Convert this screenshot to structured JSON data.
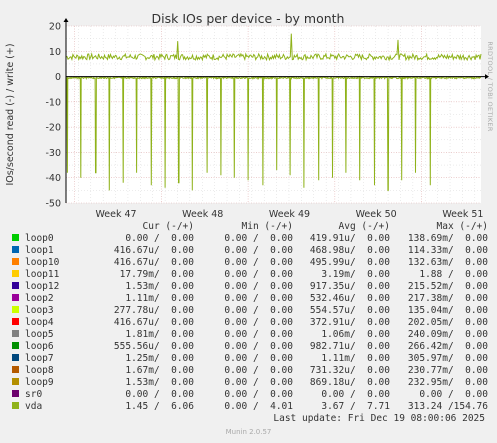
{
  "chart_data": {
    "type": "line",
    "title": "Disk IOs per device - by month",
    "ylabel": "IOs/second read (-) / write (+)",
    "ylim": [
      -50,
      20
    ],
    "yticks": [
      20,
      10,
      0,
      -10,
      -20,
      -30,
      -40,
      -50
    ],
    "xlabels": [
      "Week 47",
      "Week 48",
      "Week 49",
      "Week 50",
      "Week 51"
    ],
    "grid": true,
    "series": [
      {
        "name": "vda",
        "color": "#8fb21a",
        "write_baseline": 7.8,
        "write_noise": 1.2,
        "write_spikes": [
          {
            "day": 9.0,
            "value": 14
          },
          {
            "day": 18.2,
            "value": 17
          },
          {
            "day": 26.8,
            "value": 14.5
          }
        ],
        "read_baseline": -0.2,
        "read_spike_days": [
          0.1,
          1.2,
          2.4,
          3.5,
          4.6,
          5.7,
          6.9,
          8.0,
          9.1,
          10.2,
          11.4,
          12.5,
          13.6,
          14.7,
          15.9,
          17.0,
          18.1,
          19.2,
          20.4,
          21.5,
          22.6,
          23.7,
          24.9,
          26.0,
          27.1,
          28.2,
          29.4
        ],
        "read_spike_values": [
          -38,
          -40,
          -38,
          -45,
          -42,
          -38,
          -43,
          -44,
          -42,
          -45,
          -38,
          -39,
          -40,
          -41,
          -43,
          -37,
          -39,
          -44,
          -41,
          -40,
          -38,
          -41,
          -43,
          -45,
          -41,
          -38,
          -43
        ]
      }
    ]
  },
  "watermark": "RRDTOOL / TOBI OETIKER",
  "legend": {
    "headers": {
      "cur": "Cur (-/+)",
      "min": "Min (-/+)",
      "avg": "Avg (-/+)",
      "max": "Max (-/+)"
    },
    "rows": [
      {
        "name": "loop0",
        "color": "#00cc00",
        "cur": "0.00 /  0.00",
        "min": "0.00 /  0.00",
        "avg": "419.91u/  0.00",
        "max": "138.69m/  0.00"
      },
      {
        "name": "loop1",
        "color": "#0066b3",
        "cur": "416.67u/  0.00",
        "min": "0.00 /  0.00",
        "avg": "468.98u/  0.00",
        "max": "114.33m/  0.00"
      },
      {
        "name": "loop10",
        "color": "#ff8000",
        "cur": "416.67u/  0.00",
        "min": "0.00 /  0.00",
        "avg": "495.99u/  0.00",
        "max": "132.63m/  0.00"
      },
      {
        "name": "loop11",
        "color": "#ffcc00",
        "cur": "17.79m/  0.00",
        "min": "0.00 /  0.00",
        "avg": "3.19m/  0.00",
        "max": "1.88 /  0.00"
      },
      {
        "name": "loop12",
        "color": "#330099",
        "cur": "1.53m/  0.00",
        "min": "0.00 /  0.00",
        "avg": "917.35u/  0.00",
        "max": "215.52m/  0.00"
      },
      {
        "name": "loop2",
        "color": "#990099",
        "cur": "1.11m/  0.00",
        "min": "0.00 /  0.00",
        "avg": "532.46u/  0.00",
        "max": "217.38m/  0.00"
      },
      {
        "name": "loop3",
        "color": "#ccff00",
        "cur": "277.78u/  0.00",
        "min": "0.00 /  0.00",
        "avg": "554.57u/  0.00",
        "max": "135.04m/  0.00"
      },
      {
        "name": "loop4",
        "color": "#ff0000",
        "cur": "416.67u/  0.00",
        "min": "0.00 /  0.00",
        "avg": "372.91u/  0.00",
        "max": "202.05m/  0.00"
      },
      {
        "name": "loop5",
        "color": "#808080",
        "cur": "1.81m/  0.00",
        "min": "0.00 /  0.00",
        "avg": "1.06m/  0.00",
        "max": "240.09m/  0.00"
      },
      {
        "name": "loop6",
        "color": "#008f00",
        "cur": "555.56u/  0.00",
        "min": "0.00 /  0.00",
        "avg": "982.71u/  0.00",
        "max": "266.42m/  0.00"
      },
      {
        "name": "loop7",
        "color": "#00487d",
        "cur": "1.25m/  0.00",
        "min": "0.00 /  0.00",
        "avg": "1.11m/  0.00",
        "max": "305.97m/  0.00"
      },
      {
        "name": "loop8",
        "color": "#b35a00",
        "cur": "1.67m/  0.00",
        "min": "0.00 /  0.00",
        "avg": "731.32u/  0.00",
        "max": "230.77m/  0.00"
      },
      {
        "name": "loop9",
        "color": "#b38f00",
        "cur": "1.53m/  0.00",
        "min": "0.00 /  0.00",
        "avg": "869.18u/  0.00",
        "max": "232.95m/  0.00"
      },
      {
        "name": "sr0",
        "color": "#6b006b",
        "cur": "0.00 /  0.00",
        "min": "0.00 /  0.00",
        "avg": "0.00 /  0.00",
        "max": "0.00 /  0.00"
      },
      {
        "name": "vda",
        "color": "#8fb21a",
        "cur": "1.45 /  6.06",
        "min": "0.00 /  4.01",
        "avg": "3.67 /  7.71",
        "max": "313.24 /154.76"
      }
    ]
  },
  "last_update": "Last update: Fri Dec 19 08:00:06 2025",
  "munin_version": "Munin 2.0.57"
}
